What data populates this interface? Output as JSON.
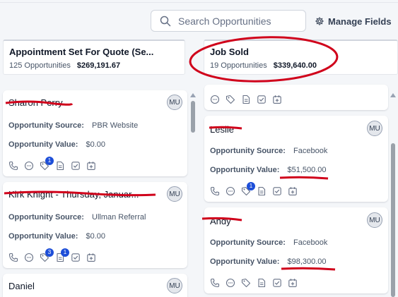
{
  "search": {
    "placeholder": "Search Opportunities"
  },
  "toolbar": {
    "manage_fields_label": "Manage Fields",
    "manage_icon": "gear-icon"
  },
  "columns": [
    {
      "title": "Appointment Set For Quote (Se...",
      "count": "125 Opportunities",
      "amount": "$269,191.67",
      "cards": [
        {
          "name": "Sharon Perry",
          "avatar": "MU",
          "source_label": "Opportunity Source:",
          "source": "PBR Website",
          "value_label": "Opportunity Value:",
          "value": "$0.00",
          "badges": {
            "tag": "1"
          }
        },
        {
          "name": "Kirk Knight - Thursday, Januar...",
          "avatar": "MU",
          "source_label": "Opportunity Source:",
          "source": "Ullman Referral",
          "value_label": "Opportunity Value:",
          "value": "$0.00",
          "badges": {
            "tag": "3",
            "note": "1"
          }
        },
        {
          "name": "Daniel",
          "avatar": "MU"
        }
      ]
    },
    {
      "title": "Job Sold",
      "count": "19 Opportunities",
      "amount": "$339,640.00",
      "cards": [
        {
          "name": "Leslie",
          "avatar": "MU",
          "source_label": "Opportunity Source:",
          "source": "Facebook",
          "value_label": "Opportunity Value:",
          "value": "$51,500.00",
          "badges": {
            "tag": "1"
          }
        },
        {
          "name": "Andy",
          "avatar": "MU",
          "source_label": "Opportunity Source:",
          "source": "Facebook",
          "value_label": "Opportunity Value:",
          "value": "$98,300.00",
          "badges": {}
        }
      ]
    }
  ],
  "colors": {
    "badge": "#1d4ed8",
    "annotation": "#d0021b",
    "border": "#e4e7ec"
  }
}
